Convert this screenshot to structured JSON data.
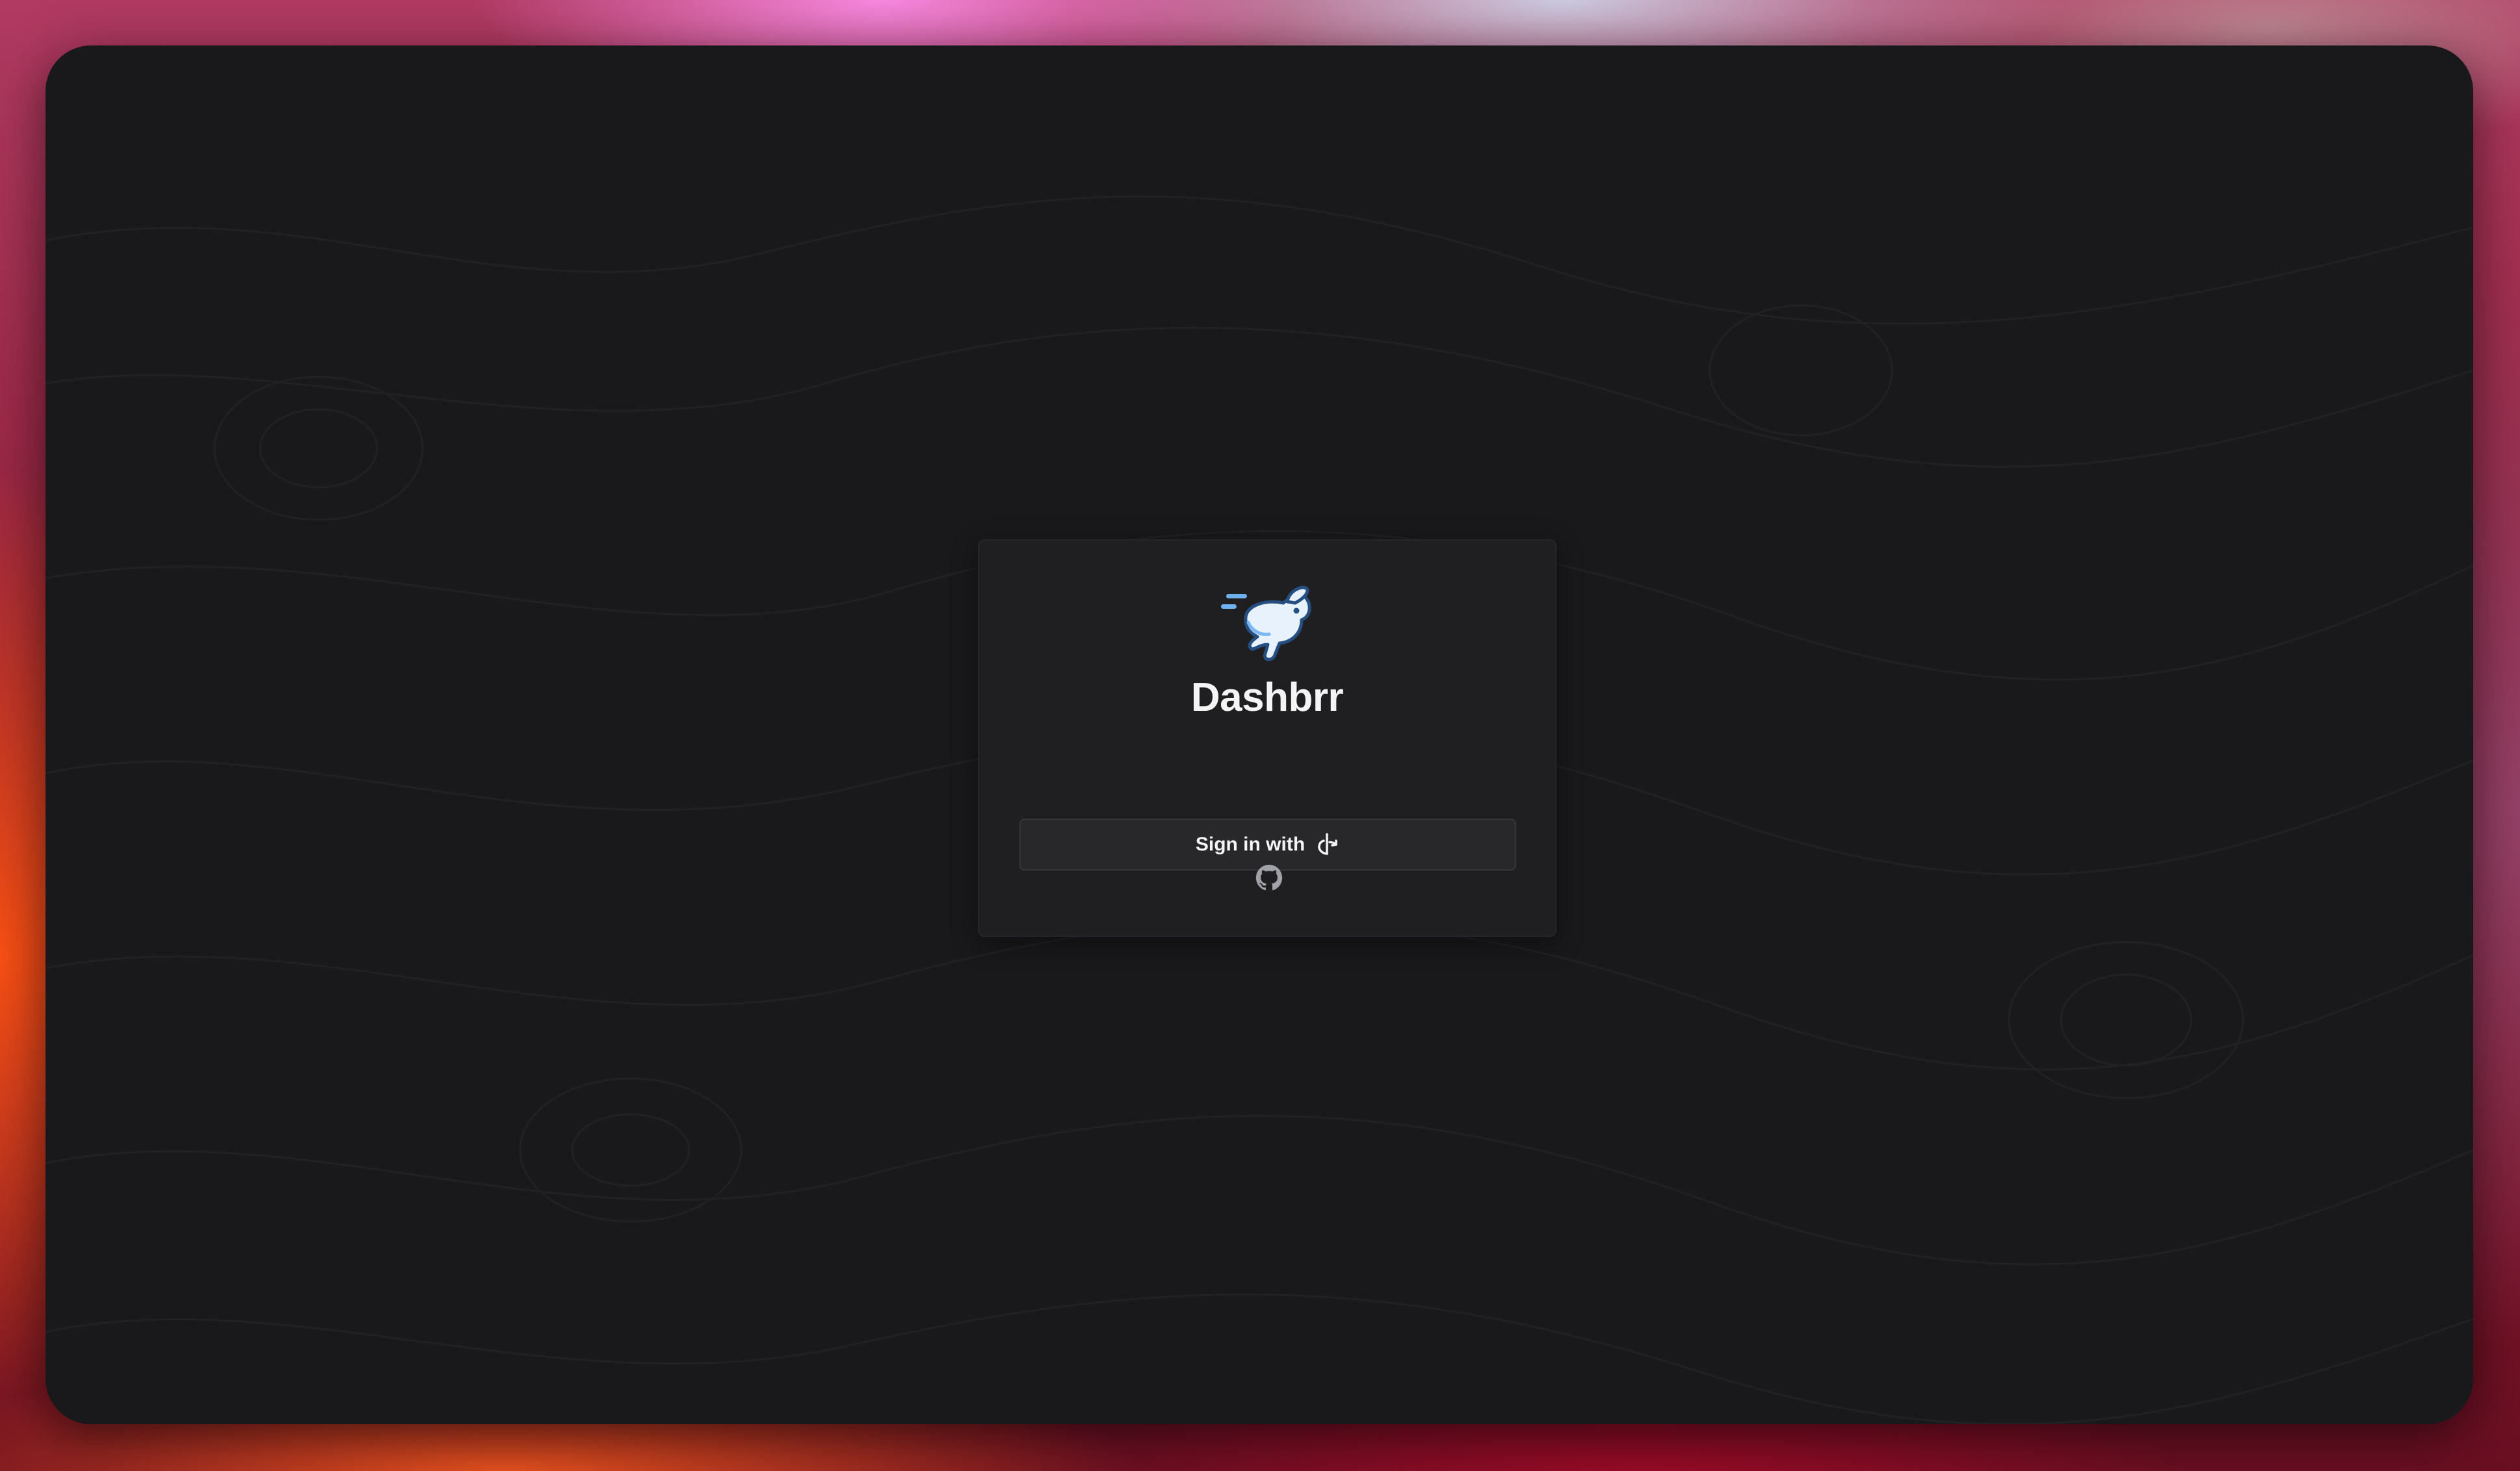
{
  "app": {
    "name": "Dashbrr",
    "logo_icon": "rabbit-logo-icon"
  },
  "login": {
    "signin_label": "Sign in with",
    "provider_icon": "oidc-icon"
  },
  "footer": {
    "link_icon": "github-icon"
  },
  "colors": {
    "window_bg": "#19191b",
    "card_bg": "#1f1f21",
    "button_bg": "#28282b",
    "text": "#f4f4f5",
    "logo_accent": "#7ab8f5"
  }
}
